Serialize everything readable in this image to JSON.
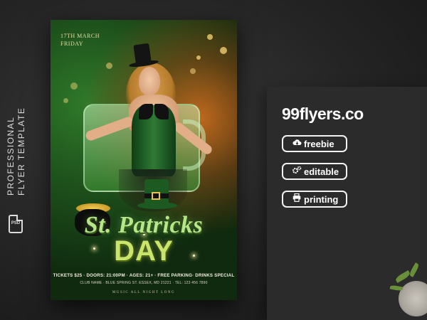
{
  "side": {
    "line1": "PROFESSIONAL",
    "line2": "FLYER TEMPLATE",
    "psd_label": "PSD"
  },
  "flyer": {
    "date_line1": "17TH MARCH",
    "date_line2": "FRIDAY",
    "title_line1": "St. Patricks",
    "title_line2": "DAY",
    "info_line1": "TICKETS $25 · DOORS: 21:00PM · AGES: 21+ · FREE PARKING· DRINKS SPECIAL",
    "info_line2": "CLUB NAME · BLUE SPRING ST. ESSEX, MD 21221 · TEL: 123 456 7890",
    "info_line3": "MUSIC ALL NIGHT LONG"
  },
  "brand": {
    "logo": "99flyers.co",
    "badges": [
      {
        "label": "freebie",
        "icon": "cloud-download-icon"
      },
      {
        "label": "editable",
        "icon": "gears-icon"
      },
      {
        "label": "printing",
        "icon": "printer-icon"
      }
    ]
  },
  "colors": {
    "background": "#242424",
    "card": "#2b2b2b",
    "title_green": "#b7e58a",
    "title_gold": "#cbe46c"
  }
}
